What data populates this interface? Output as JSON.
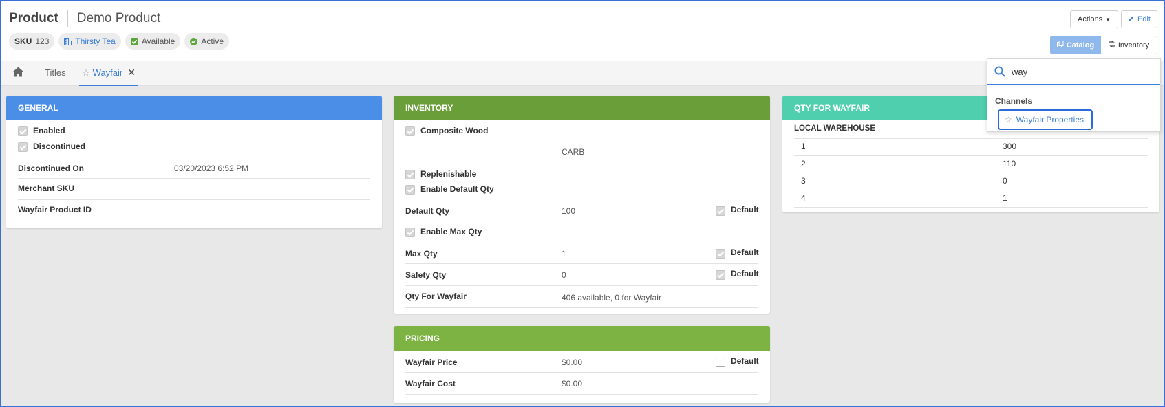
{
  "header": {
    "title": "Product",
    "subtitle": "Demo Product",
    "badges": {
      "sku_label": "SKU",
      "sku_value": "123",
      "brand": "Thirsty Tea",
      "status1": "Available",
      "status2": "Active"
    },
    "actions_label": "Actions",
    "edit_label": "Edit",
    "catalog_label": "Catalog",
    "inventory_label": "Inventory"
  },
  "tabs": {
    "titles": "Titles",
    "wayfair": "Wayfair",
    "close": "✕"
  },
  "general": {
    "heading": "GENERAL",
    "enabled": "Enabled",
    "discontinued": "Discontinued",
    "discontinued_on_label": "Discontinued On",
    "discontinued_on_value": "03/20/2023 6:52 PM",
    "merchant_sku_label": "Merchant SKU",
    "product_id_label": "Wayfair Product ID"
  },
  "inventory": {
    "heading": "INVENTORY",
    "composite_wood": "Composite Wood",
    "carb": "CARB",
    "replenishable": "Replenishable",
    "enable_default_qty": "Enable Default Qty",
    "default_qty_label": "Default Qty",
    "default_qty_value": "100",
    "default_word": "Default",
    "enable_max_qty": "Enable Max Qty",
    "max_qty_label": "Max Qty",
    "max_qty_value": "1",
    "safety_qty_label": "Safety Qty",
    "safety_qty_value": "0",
    "qty_for_wayfair_label": "Qty For Wayfair",
    "qty_for_wayfair_value": "406 available, 0 for Wayfair"
  },
  "pricing": {
    "heading": "PRICING",
    "price_label": "Wayfair Price",
    "price_value": "$0.00",
    "default_word": "Default",
    "cost_label": "Wayfair Cost",
    "cost_value": "$0.00"
  },
  "qty_panel": {
    "heading": "QTY FOR WAYFAIR",
    "col1": "LOCAL WAREHOUSE",
    "rows": [
      {
        "warehouse": "1",
        "qty": "300"
      },
      {
        "warehouse": "2",
        "qty": "110"
      },
      {
        "warehouse": "3",
        "qty": "0"
      },
      {
        "warehouse": "4",
        "qty": "1"
      }
    ]
  },
  "search": {
    "query": "way",
    "group": "Channels",
    "result": "Wayfair Properties"
  },
  "colors": {
    "general": "#4a8ee8",
    "inventory": "#6a9e38",
    "pricing": "#7db342",
    "qty": "#4fcfad",
    "accent": "#3c7fd8"
  }
}
